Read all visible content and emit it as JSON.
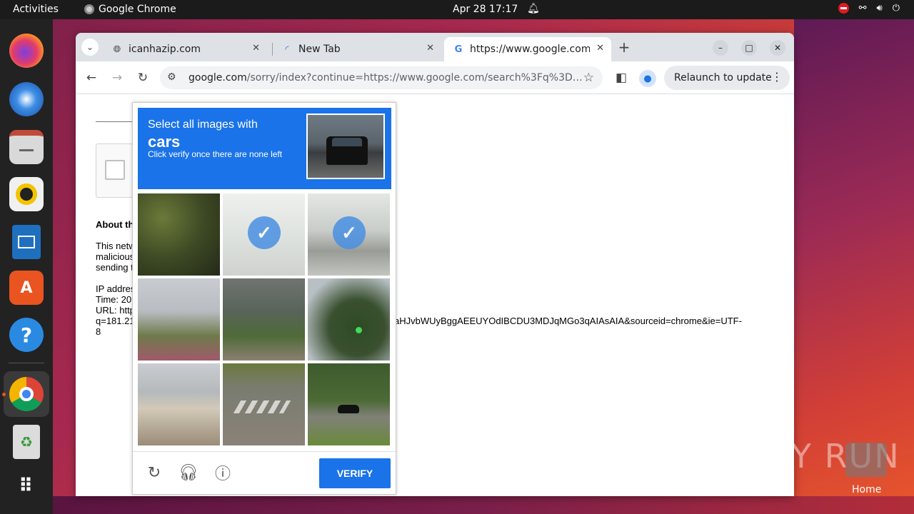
{
  "topbar": {
    "activities": "Activities",
    "app_name": "Google Chrome",
    "clock": "Apr 28  17:17"
  },
  "dock": {
    "items": [
      "firefox",
      "thunderbird",
      "files",
      "rhythmbox",
      "libreoffice-writer",
      "app-center",
      "help",
      "chrome",
      "trash",
      "app-grid"
    ]
  },
  "browser": {
    "tabs": [
      {
        "title": "icanhazip.com",
        "favicon": "globe-icon"
      },
      {
        "title": "New Tab",
        "favicon": "loading-icon"
      },
      {
        "title": "https://www.google.com",
        "favicon": "google-icon",
        "active": true
      }
    ],
    "url_host": "google.com",
    "url_path": "/sorry/index?continue=https://www.google.com/search%3Fq%3D181.2...",
    "relaunch_label": "Relaunch to update"
  },
  "page": {
    "about_heading": "About th",
    "para_line1": "This netw",
    "para_line2": "malicious",
    "para_line3": "sending t",
    "ip_label": "IP addres",
    "time_label": "Time: 20",
    "url_label": "URL: http",
    "q_prefix": "q=181.21",
    "url_tail": "aHJvbWUyBggAEEUYOdIBCDU3MDJqMGo3qAIAsAIA&sourceid=chrome&ie=UTF-",
    "url_end": "8"
  },
  "captcha": {
    "instruction_line1": "Select all images with",
    "target": "cars",
    "instruction_line3": "Click verify once there are none left",
    "selected_tiles": [
      1,
      2
    ],
    "verify_label": "VERIFY"
  },
  "watermark": {
    "text": "ANY RUN",
    "home_label": "Home"
  },
  "colors": {
    "captcha_blue": "#1a73e8",
    "ubuntu_orange": "#e95420"
  }
}
